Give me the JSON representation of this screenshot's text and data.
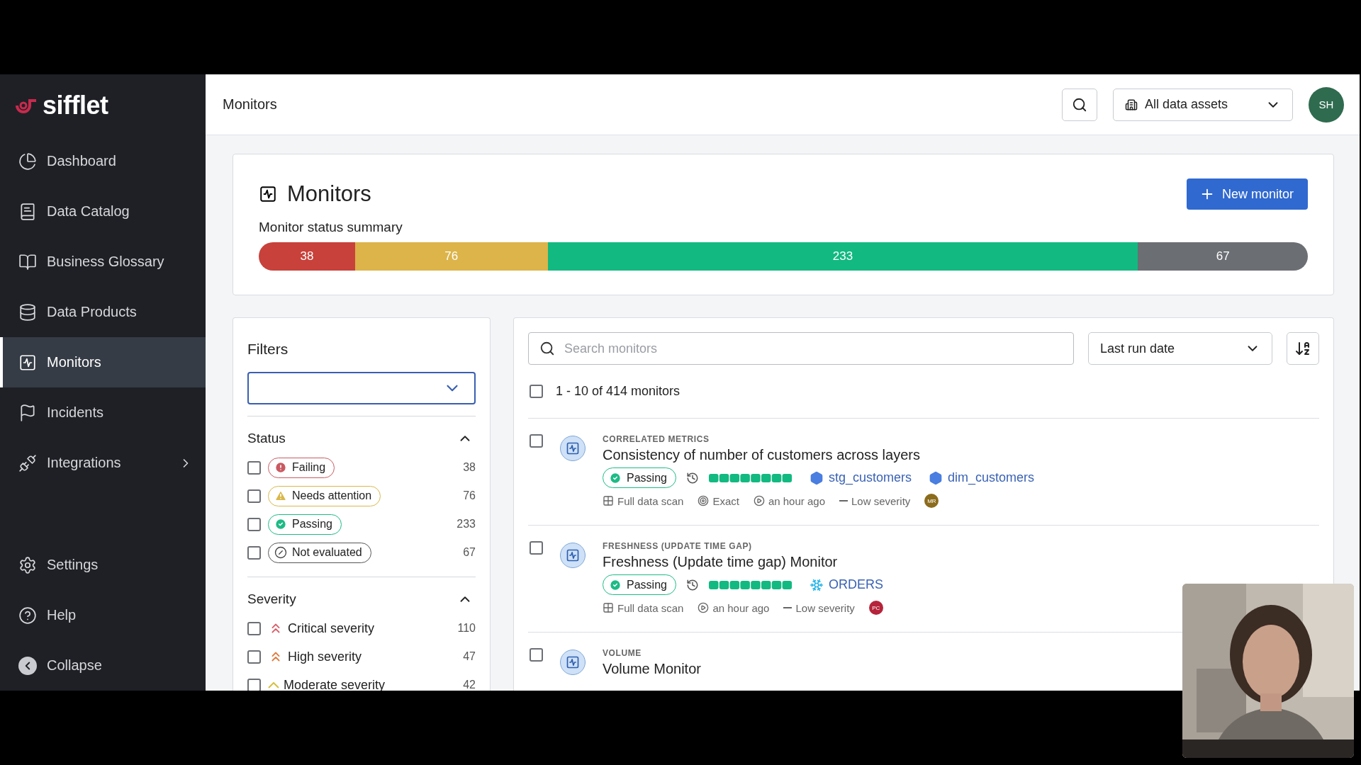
{
  "sidebar": {
    "logo": "sifflet",
    "items": [
      {
        "label": "Dashboard",
        "kind": "dashboard",
        "selected": false
      },
      {
        "label": "Data Catalog",
        "kind": "catalog",
        "selected": false
      },
      {
        "label": "Business Glossary",
        "kind": "glossary",
        "selected": false
      },
      {
        "label": "Data Products",
        "kind": "products",
        "selected": false
      },
      {
        "label": "Monitors",
        "kind": "monitors",
        "selected": true
      },
      {
        "label": "Incidents",
        "kind": "incidents",
        "selected": false
      },
      {
        "label": "Integrations",
        "kind": "integrations",
        "selected": false,
        "has_submenu": true
      }
    ],
    "bottom_items": [
      {
        "label": "Settings",
        "kind": "settings"
      },
      {
        "label": "Help",
        "kind": "help"
      },
      {
        "label": "Collapse",
        "kind": "collapse"
      }
    ]
  },
  "header": {
    "title": "Monitors",
    "asset_selector": "All data assets",
    "avatar": "SH"
  },
  "summary": {
    "title": "Monitors",
    "new_button": "New monitor",
    "subtitle": "Monitor status summary",
    "segments": [
      {
        "count": "38",
        "color": "#c8413b"
      },
      {
        "count": "76",
        "color": "#dcb44a"
      },
      {
        "count": "233",
        "color": "#12b981"
      },
      {
        "count": "67",
        "color": "#6b6e72"
      }
    ]
  },
  "filters": {
    "title": "Filters",
    "sections": [
      {
        "title": "Status",
        "expanded": true,
        "options": [
          {
            "kind": "failing",
            "label": "Failing",
            "count": "38",
            "checked": false
          },
          {
            "kind": "attention",
            "label": "Needs attention",
            "count": "76",
            "checked": false
          },
          {
            "kind": "passing",
            "label": "Passing",
            "count": "233",
            "checked": false
          },
          {
            "kind": "not_evaluated",
            "label": "Not evaluated",
            "count": "67",
            "checked": false
          }
        ]
      },
      {
        "title": "Severity",
        "expanded": true,
        "options": [
          {
            "kind": "critical",
            "label": "Critical severity",
            "count": "110",
            "checked": false
          },
          {
            "kind": "high",
            "label": "High severity",
            "count": "47",
            "checked": false
          },
          {
            "kind": "moderate",
            "label": "Moderate severity",
            "count": "42",
            "checked": false
          }
        ]
      }
    ]
  },
  "list": {
    "search_placeholder": "Search monitors",
    "sort": "Last run date",
    "count_label": "1 - 10 of 414 monitors",
    "all_checked": false,
    "monitors": [
      {
        "type": "CORRELATED METRICS",
        "name": "Consistency of number of customers across layers",
        "checked": false,
        "status": {
          "kind": "passing",
          "label": "Passing"
        },
        "assets": [
          {
            "kind": "bigquery",
            "name": "stg_customers"
          },
          {
            "kind": "bigquery",
            "name": "dim_customers"
          }
        ],
        "meta": [
          {
            "kind": "scan",
            "text": "Full data scan"
          },
          {
            "kind": "method",
            "text": "Exact"
          },
          {
            "kind": "last_run",
            "text": "an hour ago"
          },
          {
            "kind": "severity",
            "text": "Low severity"
          }
        ],
        "owner": {
          "initials": "MR",
          "color": "#8b6b1c"
        }
      },
      {
        "type": "FRESHNESS (UPDATE TIME GAP)",
        "name": "Freshness (Update time gap) Monitor",
        "checked": false,
        "status": {
          "kind": "passing",
          "label": "Passing"
        },
        "assets": [
          {
            "kind": "snowflake",
            "name": "ORDERS"
          }
        ],
        "meta": [
          {
            "kind": "scan",
            "text": "Full data scan"
          },
          {
            "kind": "last_run",
            "text": "an hour ago"
          },
          {
            "kind": "severity",
            "text": "Low severity"
          }
        ],
        "owner": {
          "initials": "PC",
          "color": "#b5243a"
        }
      },
      {
        "type": "VOLUME",
        "name": "Volume Monitor",
        "checked": false
      }
    ]
  }
}
